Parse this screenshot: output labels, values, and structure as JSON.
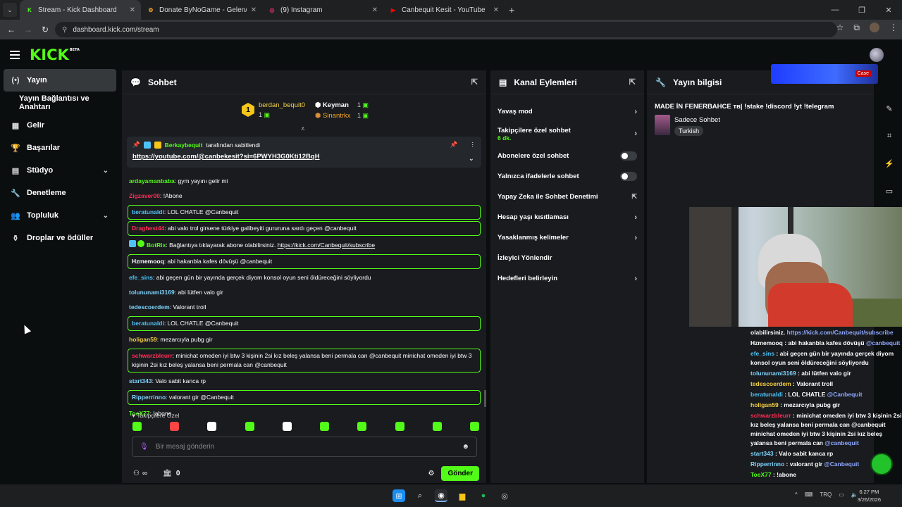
{
  "browser": {
    "tabs": [
      {
        "title": "Stream - Kick Dashboard",
        "icon": "K",
        "color": "#53fc18",
        "active": true
      },
      {
        "title": "Donate ByNoGame - Gelen/Giden",
        "icon": "⚙",
        "color": "#f5a623",
        "active": false
      },
      {
        "title": "(9) Instagram",
        "icon": "◎",
        "color": "#e1306c",
        "active": false
      },
      {
        "title": "Canbequit Kesit - YouTube",
        "icon": "▶",
        "color": "#ff0000",
        "active": false
      }
    ],
    "url": "dashboard.kick.com/stream"
  },
  "sidebar": {
    "items": [
      {
        "label": "Yayın",
        "icon": "(•)",
        "active": true
      },
      {
        "label": "Yayın Bağlantısı ve Anahtarı",
        "sub": true
      },
      {
        "label": "Gelir",
        "icon": "▦"
      },
      {
        "label": "Başarılar",
        "icon": "🏆"
      },
      {
        "label": "Stüdyo",
        "icon": "▤",
        "chevron": true
      },
      {
        "label": "Denetleme",
        "icon": "🔧"
      },
      {
        "label": "Topluluk",
        "icon": "👥",
        "chevron": true
      },
      {
        "label": "Droplar ve ödüller",
        "icon": "⚱"
      }
    ]
  },
  "chat": {
    "title": "Sohbet",
    "leaders": {
      "first": {
        "name": "berdan_bequit0",
        "count": "1"
      },
      "second": {
        "name": "Keyman",
        "count": "1"
      },
      "third": {
        "name": "Sinantrkx",
        "count": "1"
      }
    },
    "pinned": {
      "by": "Berkaybequit",
      "by_suffix": "tarafından sabitlendi",
      "link": "https://youtube.com/@canbekesit?si=6PWYH3G0Kti12BqH"
    },
    "messages": [
      {
        "user": "ardayamanbaba",
        "color": "#53fc18",
        "text": "gym yayını gelir mi",
        "hl": false
      },
      {
        "user": "Zigzaver00",
        "color": "#ff2d55",
        "text": "!Abone",
        "hl": false
      },
      {
        "user": "beratunaldi",
        "color": "#4fc3f7",
        "text": "LOL CHATLE @Canbequit",
        "hl": true
      },
      {
        "user": "Draghest44",
        "color": "#ff2d55",
        "text": "abi valo trol girsene türkiye galibeyiti gururuna sardı geçen @canbequit",
        "hl": true
      },
      {
        "user": "BotRix",
        "color": "#53fc18",
        "text": "Bağlantıya tıklayarak abone olabilirsiniz.",
        "link": "https://kick.com/Canbequit/subscribe",
        "hl": false
      },
      {
        "user": "Hzmemooq",
        "color": "#ffffff",
        "text": "abi hakanbla kafes dövüşü @canbequit",
        "hl": true
      },
      {
        "user": "efe_sins",
        "color": "#4fc3f7",
        "text": "abi geçen gün bir yayında gerçek diyom konsol oyun seni öldüreceğini söyliyordu",
        "hl": false
      },
      {
        "user": "tolununami3169",
        "color": "#7dd3fc",
        "text": "abi lütfen valo gir",
        "hl": false
      },
      {
        "user": "tedescoerdem",
        "color": "#7dd3fc",
        "text": "Valorant troll",
        "hl": false
      },
      {
        "user": "beratunaldi",
        "color": "#4fc3f7",
        "text": "LOL CHATLE @Canbequit",
        "hl": true
      },
      {
        "user": "holigan59",
        "color": "#f5d142",
        "text": "mezarcıyla pubg gir",
        "hl": false
      },
      {
        "user": "schwarzbleurr",
        "color": "#ff2d55",
        "text": "minichat omeden iyi btw 3 kişinin 2si kız beleş yalansa beni permala can @canbequit minichat omeden iyi btw 3 kişinin 2si kız beleş yalansa beni permala can @canbequit",
        "hl": true
      },
      {
        "user": "start343",
        "color": "#7dd3fc",
        "text": "Valo sabit kanca rp",
        "hl": false
      },
      {
        "user": "Ripperrinno",
        "color": "#7dd3fc",
        "text": "valorant gir @Canbequit",
        "hl": true
      },
      {
        "user": "ToeX77",
        "color": "#53fc18",
        "text": "!abone",
        "hl": false
      }
    ],
    "followers_only": "Takipçilere Özel",
    "input_placeholder": "Bir mesaj gönderin",
    "infinity": "∞",
    "gift_count": "0",
    "send_label": "Gönder"
  },
  "actions": {
    "title": "Kanal Eylemleri",
    "items": [
      {
        "label": "Yavaş mod",
        "type": "chevron"
      },
      {
        "label": "Takipçilere özel sohbet",
        "sub": "6 dk.",
        "type": "chevron"
      },
      {
        "label": "Abonelere özel sohbet",
        "type": "toggle"
      },
      {
        "label": "Yalnızca ifadelerle sohbet",
        "type": "toggle"
      },
      {
        "label": "Yapay Zeka ile Sohbet Denetimi",
        "type": "external"
      },
      {
        "label": "Hesap yaşı kısıtlaması",
        "type": "chevron"
      },
      {
        "label": "Yasaklanmış kelimeler",
        "type": "chevron"
      },
      {
        "label": "İzleyici Yönlendir",
        "type": "none"
      },
      {
        "label": "Hedefleri belirleyin",
        "type": "chevron"
      }
    ]
  },
  "info": {
    "title": "Yayın bilgisi",
    "stream_title": "MADE İN FENERBAHCE тв| !stake !discord !yt !telegram",
    "category": "Sadece Sohbet",
    "language": "Turkish",
    "ad_badge": "Case"
  },
  "overlay": {
    "lines": [
      {
        "user": "",
        "text": "olabilirsiniz.",
        "link": "https://kick.com/Canbequit/subscribe"
      },
      {
        "user": "Hzmemooq",
        "color": "#ffffff",
        "text": ": abi hakanbla kafes dövüşü",
        "mention": "@canbequit"
      },
      {
        "user": "efe_sins",
        "color": "#4fc3f7",
        "text": ": abi geçen gün bir yayında gerçek diyom konsol oyun seni öldüreceğini söyliyordu"
      },
      {
        "user": "tolununami3169",
        "color": "#7dd3fc",
        "text": ": abi lütfen valo gir"
      },
      {
        "user": "tedescoerdem",
        "color": "#f5d142",
        "text": ": Valorant troll"
      },
      {
        "user": "beratunaldi",
        "color": "#4fc3f7",
        "text": ": LOL CHATLE",
        "mention": "@Canbequit"
      },
      {
        "user": "holigan59",
        "color": "#f5d142",
        "text": ": mezarcıyla pubg gir"
      },
      {
        "user": "schwarzbleurr",
        "color": "#ff2d55",
        "text": ": minichat omeden iyi btw 3 kişinin 2si kız beleş yalansa beni permala can @canbequit minichat omeden iyi btw 3 kişinin 2si kız beleş yalansa beni permala can",
        "mention": "@canbequit"
      },
      {
        "user": "start343",
        "color": "#7dd3fc",
        "text": ": Valo sabit kanca rp"
      },
      {
        "user": "Ripperrinno",
        "color": "#7dd3fc",
        "text": ": valorant gir",
        "mention": "@Canbequit"
      },
      {
        "user": "ToeX77",
        "color": "#53fc18",
        "text": ": !abone"
      }
    ]
  },
  "taskbar": {
    "lang": "TRQ",
    "time": "6:27 PM",
    "date": "3/26/2026"
  }
}
